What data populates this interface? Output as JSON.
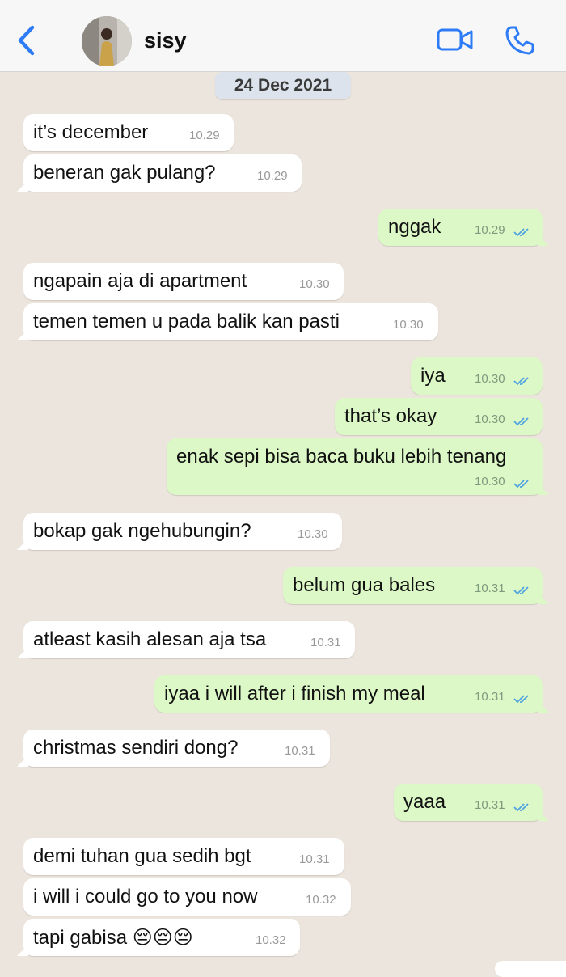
{
  "header": {
    "contact_name": "sisy",
    "back_icon": "chevron-left-icon",
    "video_icon": "video-camera-icon",
    "call_icon": "phone-icon",
    "accent_color": "#2d7bf6"
  },
  "date_chip": "24 Dec 2021",
  "messages": [
    {
      "text": "it’s december",
      "time": "10.29",
      "direction": "in"
    },
    {
      "text": "beneran gak pulang?",
      "time": "10.29",
      "direction": "in"
    },
    {
      "text": "nggak",
      "time": "10.29",
      "direction": "out",
      "status": "read"
    },
    {
      "text": "ngapain aja di apartment",
      "time": "10.30",
      "direction": "in"
    },
    {
      "text": "temen temen u pada balik kan pasti",
      "time": "10.30",
      "direction": "in"
    },
    {
      "text": "iya",
      "time": "10.30",
      "direction": "out",
      "status": "read"
    },
    {
      "text": "that’s okay",
      "time": "10.30",
      "direction": "out",
      "status": "read"
    },
    {
      "text": "enak sepi bisa baca buku lebih tenang",
      "time": "10.30",
      "direction": "out",
      "status": "read"
    },
    {
      "text": "bokap gak ngehubungin?",
      "time": "10.30",
      "direction": "in"
    },
    {
      "text": "belum gua bales",
      "time": "10.31",
      "direction": "out",
      "status": "read"
    },
    {
      "text": "atleast kasih alesan aja tsa",
      "time": "10.31",
      "direction": "in"
    },
    {
      "text": "iyaa i will after i finish my meal",
      "time": "10.31",
      "direction": "out",
      "status": "read"
    },
    {
      "text": "christmas sendiri dong?",
      "time": "10.31",
      "direction": "in"
    },
    {
      "text": "yaaa",
      "time": "10.31",
      "direction": "out",
      "status": "read"
    },
    {
      "text": "demi tuhan gua sedih bgt",
      "time": "10.31",
      "direction": "in"
    },
    {
      "text": "i will i could go to you now",
      "time": "10.32",
      "direction": "in"
    },
    {
      "text": "tapi gabisa 😔😔😔",
      "time": "10.32",
      "direction": "in"
    }
  ],
  "colors": {
    "background": "#ece5dd",
    "incoming_bubble": "#ffffff",
    "outgoing_bubble": "#dcf8c6",
    "read_ticks": "#4fa3e0"
  }
}
